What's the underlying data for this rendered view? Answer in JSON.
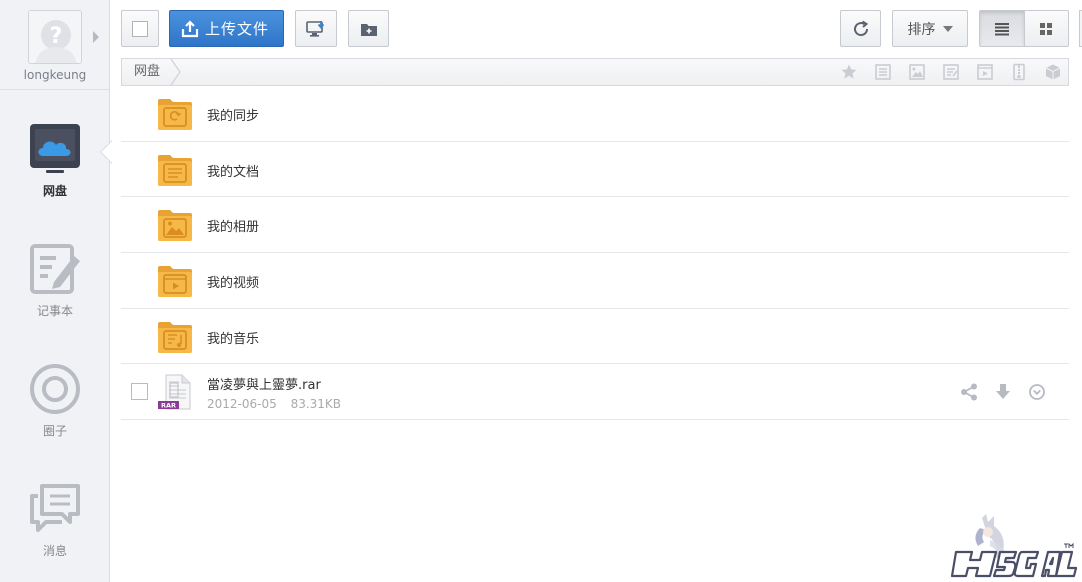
{
  "user": {
    "name": "longkeung"
  },
  "nav": [
    {
      "label": "网盘",
      "icon": "cloud-drive-icon",
      "active": true
    },
    {
      "label": "记事本",
      "icon": "notepad-icon",
      "active": false
    },
    {
      "label": "圈子",
      "icon": "circle-icon",
      "active": false
    },
    {
      "label": "消息",
      "icon": "message-icon",
      "active": false
    }
  ],
  "toolbar": {
    "upload_label": "上传文件",
    "sort_label": "排序"
  },
  "breadcrumb": {
    "root": "网盘"
  },
  "folders": [
    {
      "name": "我的同步",
      "icon": "sync-folder-icon"
    },
    {
      "name": "我的文档",
      "icon": "documents-folder-icon"
    },
    {
      "name": "我的相册",
      "icon": "photos-folder-icon"
    },
    {
      "name": "我的视频",
      "icon": "videos-folder-icon"
    },
    {
      "name": "我的音乐",
      "icon": "music-folder-icon"
    }
  ],
  "files": [
    {
      "name": "當凌夢與上靈夢.rar",
      "date": "2012-06-05",
      "size": "83.31KB",
      "icon": "rar-file-icon",
      "badge": "RAR"
    }
  ],
  "colors": {
    "accent": "#3a83d4",
    "folder": "#f7b84a",
    "folder_dark": "#e9a334",
    "sidebar_bg": "#f1f2f6"
  }
}
